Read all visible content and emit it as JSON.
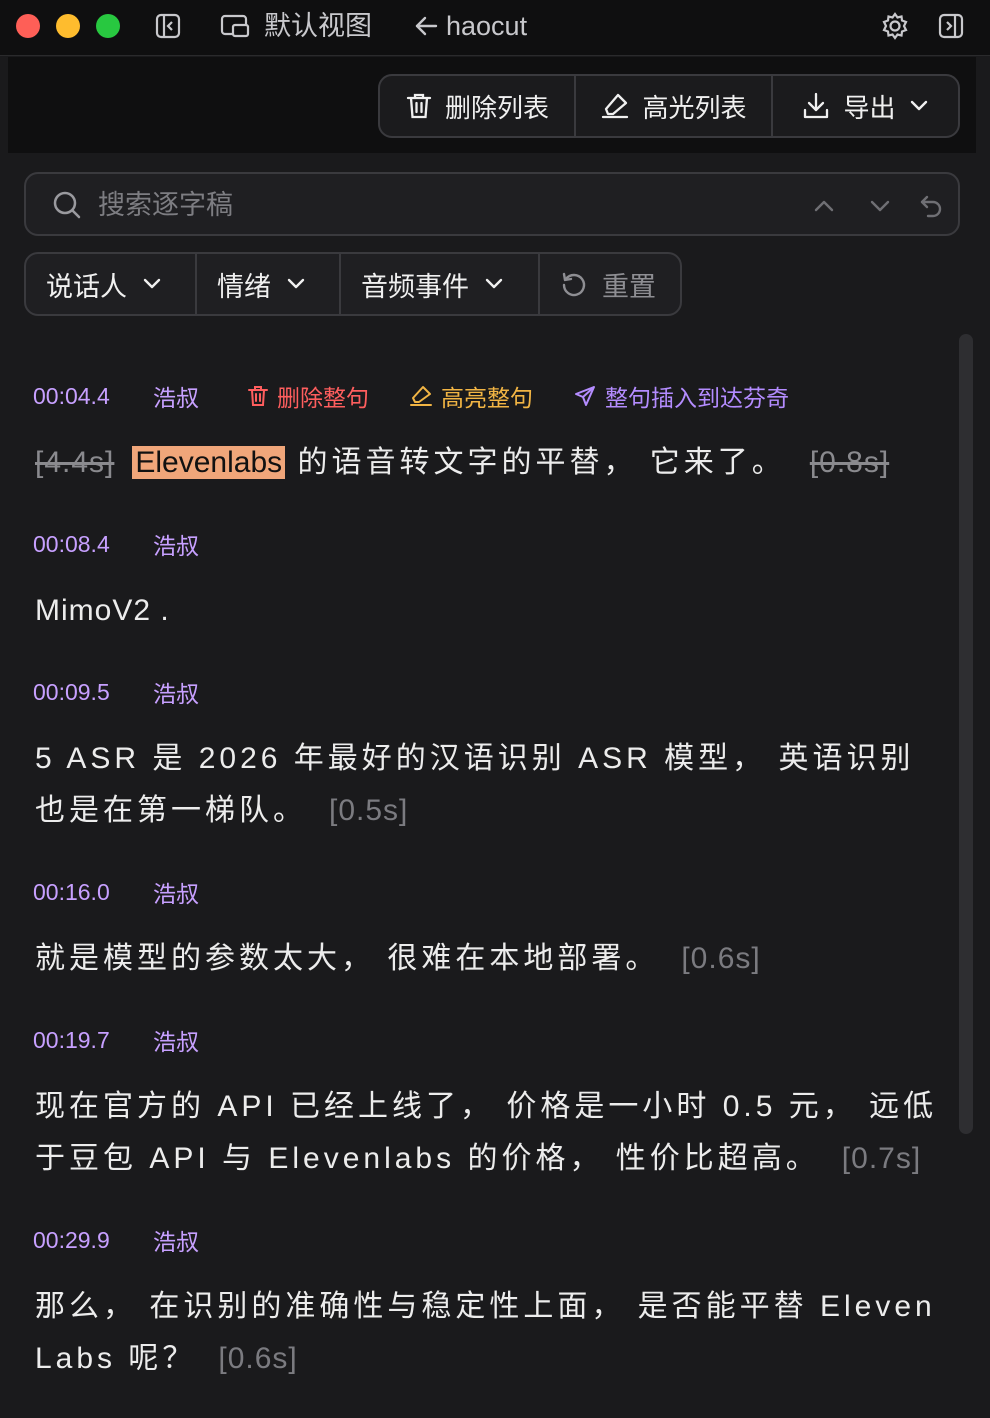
{
  "window": {
    "view_label": "默认视图",
    "back_label": "haocut"
  },
  "toolbar": {
    "delete_list": "删除列表",
    "highlight_list": "高光列表",
    "export": "导出"
  },
  "search": {
    "placeholder": "搜索逐字稿"
  },
  "filters": {
    "speaker": "说话人",
    "emotion": "情绪",
    "audio_event": "音频事件",
    "reset": "重置"
  },
  "segment_actions": {
    "delete_sentence": "删除整句",
    "highlight_sentence": "高亮整句",
    "insert_sentence": "整句插入到达芬奇"
  },
  "segments": [
    {
      "time": "00:04.4",
      "speaker": "浩叔",
      "pre_pause": "[4.4s]",
      "highlight": "Elevenlabs",
      "text": " 的语音转文字的平替， 它来了。",
      "pause": "[0.8s]"
    },
    {
      "time": "00:08.4",
      "speaker": "浩叔",
      "text": "MimoV2 .",
      "pause": ""
    },
    {
      "time": "00:09.5",
      "speaker": "浩叔",
      "text": "5 ASR 是 2026 年最好的汉语识别 ASR 模型， 英语识别也是在第一梯队。",
      "pause": "[0.5s]"
    },
    {
      "time": "00:16.0",
      "speaker": "浩叔",
      "text": "就是模型的参数太大， 很难在本地部署。",
      "pause": "[0.6s]"
    },
    {
      "time": "00:19.7",
      "speaker": "浩叔",
      "text": "现在官方的 API 已经上线了， 价格是一小时 0.5 元， 远低于豆包 API 与 Elevenlabs 的价格， 性价比超高。",
      "pause": "[0.7s]"
    },
    {
      "time": "00:29.9",
      "speaker": "浩叔",
      "text": "那么， 在识别的准确性与稳定性上面， 是否能平替 Eleven Labs 呢？",
      "pause": "[0.6s]"
    }
  ]
}
